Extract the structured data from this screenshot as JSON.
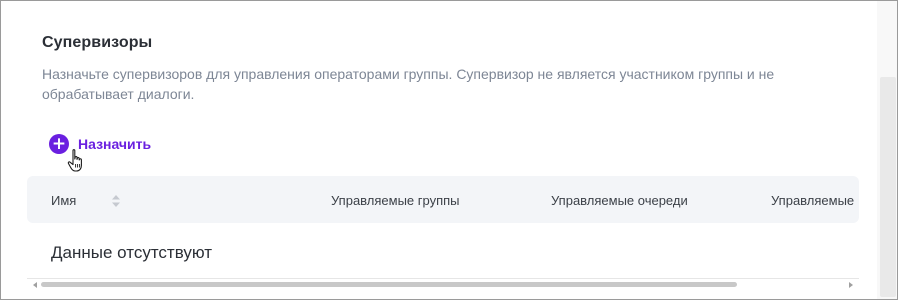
{
  "section": {
    "title": "Супервизоры",
    "description": "Назначьте супервизоров для управления операторами группы. Супервизор не является участником группы и не обрабатывает диалоги."
  },
  "assign_button": {
    "icon": "plus-circle-icon",
    "label": "Назначить",
    "color": "#6a1fe0"
  },
  "table": {
    "columns": [
      {
        "label": "Имя",
        "sortable": true
      },
      {
        "label": "Управляемые группы"
      },
      {
        "label": "Управляемые очереди"
      },
      {
        "label": "Управляемые"
      }
    ],
    "empty_text": "Данные отсутствуют"
  }
}
